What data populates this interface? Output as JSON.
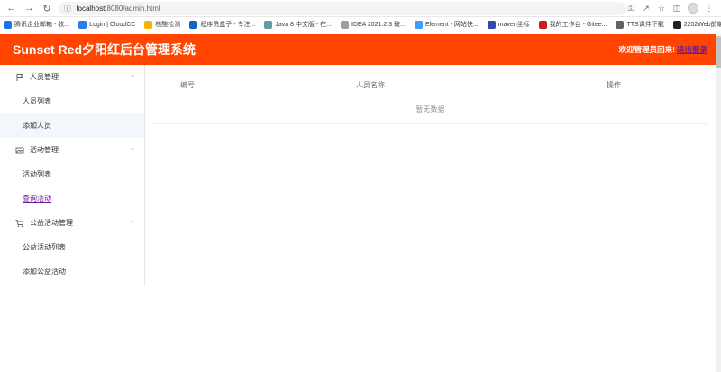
{
  "browser": {
    "url_host": "localhost",
    "url_rest": ":8080/admin.html",
    "bookmarks": [
      {
        "label": "腾讯企业邮箱 - 收...",
        "icon": "mail-icon",
        "color": "#1a73e8"
      },
      {
        "label": "Login | CloudCC",
        "icon": "cloud-icon",
        "color": "#2b7de9"
      },
      {
        "label": "核酸检测",
        "icon": "folder-icon",
        "color": "#f4b400"
      },
      {
        "label": "程序员盒子 - 专注...",
        "icon": "box-icon",
        "color": "#1565c0"
      },
      {
        "label": "Java 8 中文版 - 在...",
        "icon": "java-icon",
        "color": "#5f9ea0"
      },
      {
        "label": "IDEA 2021.2.3 破...",
        "icon": "idea-icon",
        "color": "#9e9e9e"
      },
      {
        "label": "Element - 网站快...",
        "icon": "element-icon",
        "color": "#409eff"
      },
      {
        "label": "maven坐标",
        "icon": "maven-icon",
        "color": "#3949ab"
      },
      {
        "label": "我的工作台 - Gitee...",
        "icon": "gitee-icon",
        "color": "#c71d23"
      },
      {
        "label": "TTS课件下载",
        "icon": "folder-icon",
        "color": "#5f6368"
      },
      {
        "label": "2202Web前端笔记",
        "icon": "note-icon",
        "color": "#202124"
      }
    ]
  },
  "header": {
    "title": "Sunset Red夕阳红后台管理系统",
    "welcome": "欢迎管理员回来!",
    "logout": "退出登录",
    "bg_color": "#ff4500"
  },
  "sidebar": {
    "groups": [
      {
        "title": "人员管理",
        "icon": "flag-icon",
        "items": [
          {
            "label": "人员列表",
            "state": "normal"
          },
          {
            "label": "添加人员",
            "state": "active"
          }
        ]
      },
      {
        "title": "活动管理",
        "icon": "picture-icon",
        "items": [
          {
            "label": "活动列表",
            "state": "normal"
          },
          {
            "label": "查询活动",
            "state": "visited"
          }
        ]
      },
      {
        "title": "公益活动管理",
        "icon": "cart-icon",
        "items": [
          {
            "label": "公益活动列表",
            "state": "normal"
          },
          {
            "label": "添加公益活动",
            "state": "normal"
          }
        ]
      }
    ]
  },
  "table": {
    "columns": [
      "编号",
      "人员名称",
      "操作"
    ],
    "empty_text": "暂无数据"
  }
}
